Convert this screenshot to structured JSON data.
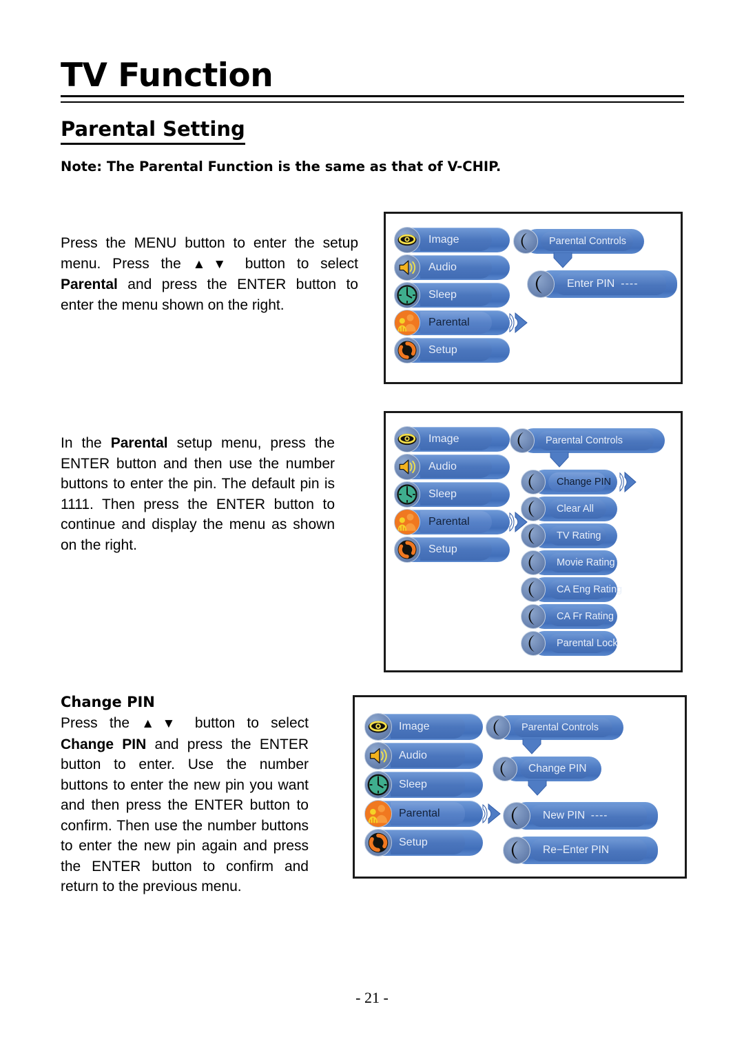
{
  "page": {
    "title": "TV Function",
    "section_title": "Parental Setting",
    "note": "Note: The Parental Function is the same as that of V-CHIP.",
    "page_number": "- 21 -"
  },
  "paragraphs": {
    "p1_a": "Press the MENU button to enter the setup menu. Press the ",
    "p1_arrows": "▲▼",
    "p1_b": " button to select ",
    "p1_bold": "Parental",
    "p1_c": " and press the ENTER button to enter the menu shown on the right.",
    "p2_a": "In the ",
    "p2_bold": "Parental",
    "p2_b": " setup menu, press the ENTER button and then use the number buttons to enter the pin. The default pin is 1111. Then press the ENTER button to continue and display the menu as shown on the right.",
    "subhead3": "Change PIN",
    "p3_a": "Press the ",
    "p3_arrows": "▲▼",
    "p3_b": " button to select ",
    "p3_bold": "Change PIN",
    "p3_c": " and press the ENTER button to enter. Use the number buttons to enter the new pin you want and then press the ENTER button to confirm. Then use the number buttons to enter the new pin again and press the ENTER button to confirm and return to the previous menu."
  },
  "main_menu": {
    "items": [
      {
        "label": "Image",
        "icon": "eye-icon"
      },
      {
        "label": "Audio",
        "icon": "speaker-icon"
      },
      {
        "label": "Sleep",
        "icon": "clock-icon"
      },
      {
        "label": "Parental",
        "icon": "family-icon"
      },
      {
        "label": "Setup",
        "icon": "refresh-icon"
      }
    ],
    "selected": "Parental"
  },
  "diagram1": {
    "header": "Parental Controls",
    "items": [
      {
        "label": "Enter PIN",
        "value": "----"
      }
    ]
  },
  "diagram2": {
    "header": "Parental Controls",
    "items": [
      {
        "label": "Change PIN",
        "selected": true
      },
      {
        "label": "Clear All",
        "selected": false
      },
      {
        "label": "TV Rating",
        "selected": false
      },
      {
        "label": "Movie Rating",
        "selected": false
      },
      {
        "label": "CA Eng Rating",
        "selected": false
      },
      {
        "label": "CA Fr Rating",
        "selected": false
      },
      {
        "label": "Parental Lock",
        "selected": false
      }
    ]
  },
  "diagram3": {
    "header": "Parental Controls",
    "submenu": "Change PIN",
    "items": [
      {
        "label": "New PIN",
        "value": "----"
      },
      {
        "label": "Re−Enter PIN",
        "value": ""
      }
    ]
  },
  "colors": {
    "pill_blue": "#4f7cc4",
    "pill_light": "#6f9ad8",
    "icon_eye": "#f5e04a",
    "icon_speaker": "#f2b21e",
    "icon_clock": "#3fae8e",
    "icon_family_orange": "#f07820",
    "icon_family_yellow": "#f5d327",
    "icon_setup": "#f07820",
    "frame": "#1a1a1a"
  }
}
